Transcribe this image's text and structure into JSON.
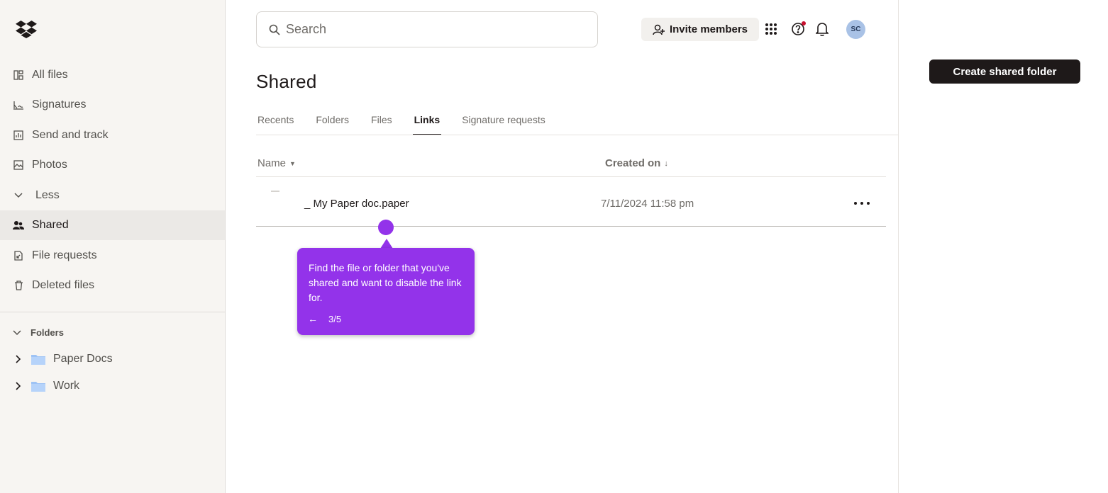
{
  "search": {
    "placeholder": "Search"
  },
  "header": {
    "invite_label": "Invite members",
    "avatar_initials": "SC"
  },
  "actions": {
    "create_shared_folder": "Create shared folder"
  },
  "sidebar": {
    "items": [
      {
        "label": "All files",
        "icon": "all-files-icon"
      },
      {
        "label": "Signatures",
        "icon": "signature-icon"
      },
      {
        "label": "Send and track",
        "icon": "chart-icon"
      },
      {
        "label": "Photos",
        "icon": "photo-icon"
      },
      {
        "label": "Less",
        "icon": "chevron-down-icon"
      },
      {
        "label": "Shared",
        "icon": "shared-people-icon",
        "active": true
      },
      {
        "label": "File requests",
        "icon": "file-request-icon"
      },
      {
        "label": "Deleted files",
        "icon": "trash-icon"
      }
    ],
    "folders_heading": "Folders",
    "folders": [
      {
        "label": "Paper Docs"
      },
      {
        "label": "Work"
      }
    ]
  },
  "main": {
    "title": "Shared",
    "tabs": [
      {
        "label": "Recents"
      },
      {
        "label": "Folders"
      },
      {
        "label": "Files"
      },
      {
        "label": "Links",
        "active": true
      },
      {
        "label": "Signature requests"
      }
    ],
    "table": {
      "columns": {
        "name": "Name",
        "created": "Created on"
      },
      "rows": [
        {
          "name": "_ My Paper doc.paper",
          "created": "7/11/2024 11:58 pm"
        }
      ]
    }
  },
  "tooltip": {
    "text": "Find the file or folder that you've shared and want to disable the link for.",
    "step": "3/5",
    "back_glyph": "←",
    "color": "#9333ea"
  }
}
